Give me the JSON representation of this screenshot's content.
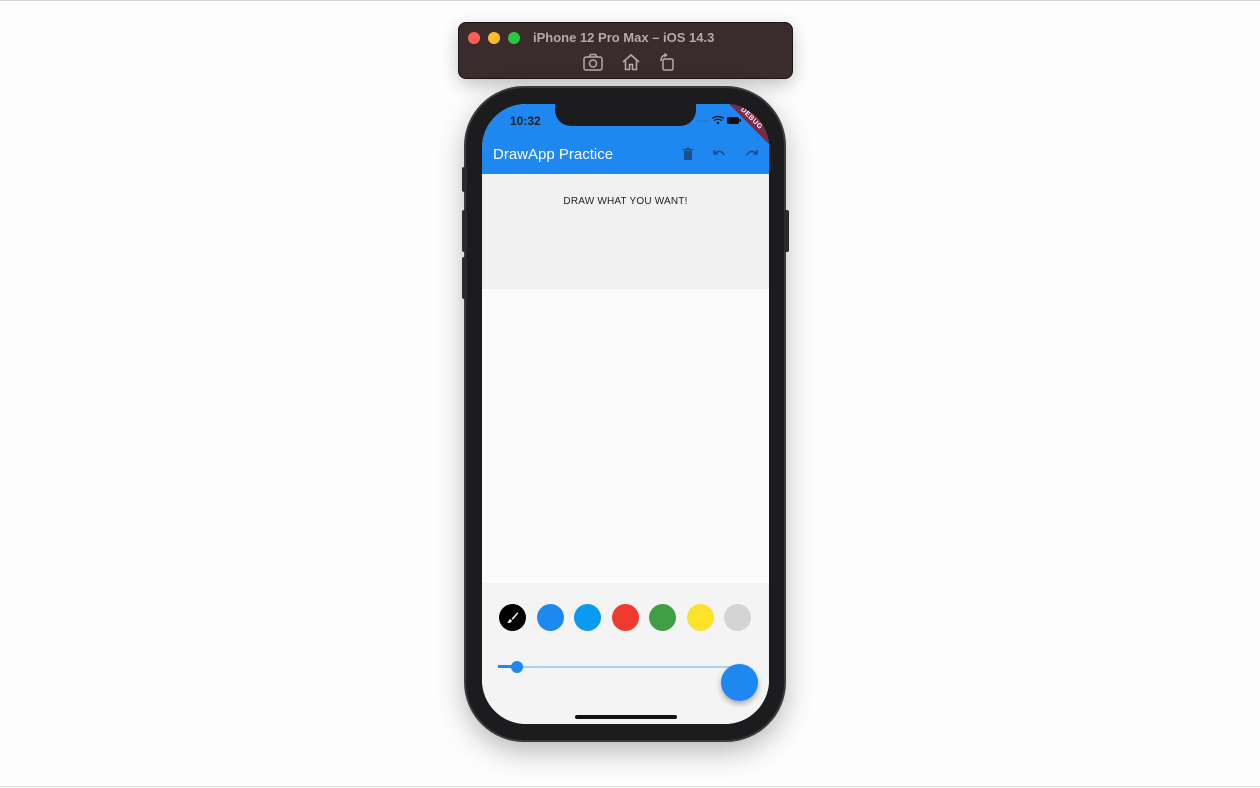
{
  "simulator": {
    "title": "iPhone 12 Pro Max – iOS 14.3",
    "buttons": [
      {
        "name": "screenshot-icon"
      },
      {
        "name": "home-icon"
      },
      {
        "name": "rotate-icon"
      }
    ]
  },
  "status_bar": {
    "time": "10:32",
    "icons": [
      "signal-dots-icon",
      "wifi-icon",
      "battery-icon"
    ]
  },
  "app_bar": {
    "title": "DrawApp Practice",
    "actions": [
      "delete-icon",
      "undo-icon",
      "redo-icon"
    ],
    "debug_banner": "DEBUG",
    "color": "#1f87f0"
  },
  "canvas": {
    "prompt": "DRAW WHAT YOU WANT!"
  },
  "palette": {
    "colors": [
      {
        "name": "black",
        "hex": "#000000",
        "selected": true,
        "icon": "brush-icon"
      },
      {
        "name": "blue",
        "hex": "#1f87f0"
      },
      {
        "name": "light-blue",
        "hex": "#0a9bf0"
      },
      {
        "name": "red",
        "hex": "#ee3a2f"
      },
      {
        "name": "green",
        "hex": "#3f9f45"
      },
      {
        "name": "yellow",
        "hex": "#fbe22b"
      },
      {
        "name": "grey",
        "hex": "#d4d4d4"
      }
    ]
  },
  "stroke_slider": {
    "value_fraction": 0.08
  },
  "fab": {
    "color": "#1f87f0"
  }
}
